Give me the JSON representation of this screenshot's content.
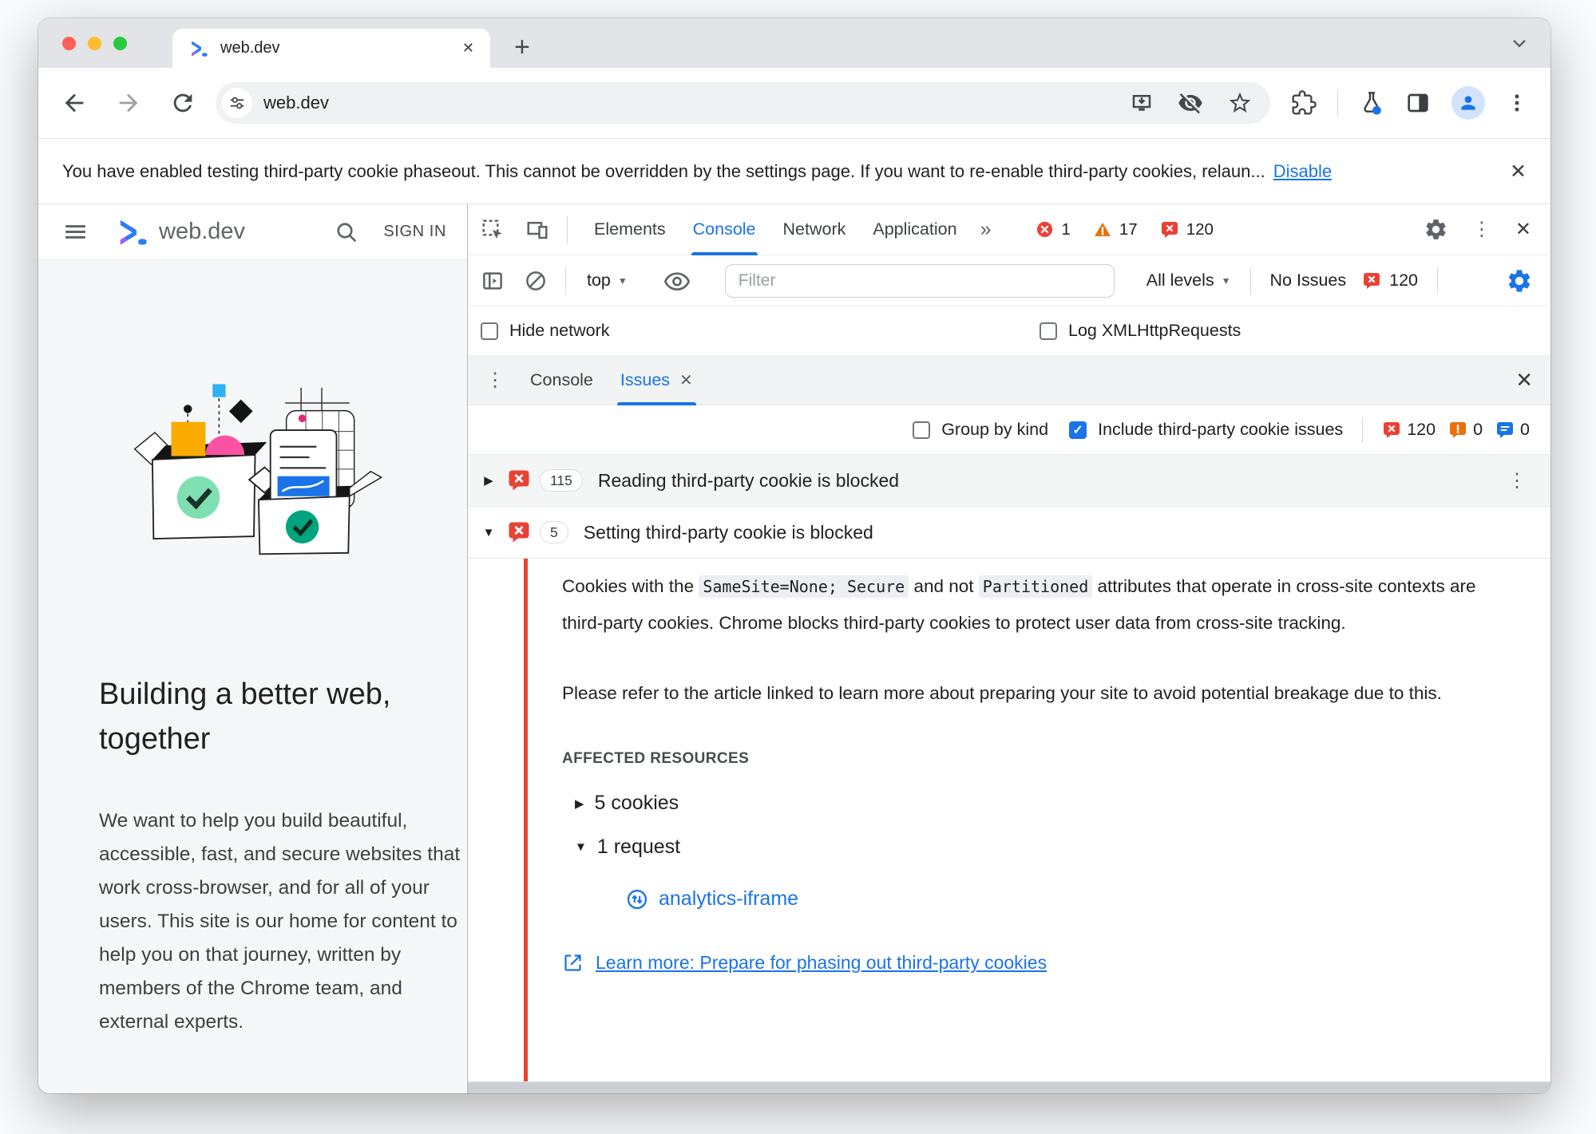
{
  "browser": {
    "tab_title": "web.dev",
    "url": "web.dev",
    "new_tab_glyph": "+",
    "tab_close_glyph": "✕"
  },
  "notification": {
    "message": "You have enabled testing third-party cookie phaseout. This cannot be overridden by the settings page. If you want to re-enable third-party cookies, relaun...",
    "action": "Disable",
    "close_glyph": "✕"
  },
  "site": {
    "brand": "web.dev",
    "sign_in": "SIGN IN",
    "heading": "Building a better web, together",
    "intro": "We want to help you build beautiful, accessible, fast, and secure websites that work cross-browser, and for all of your users. This site is our home for content to help you on that journey, written by members of the Chrome team, and external experts."
  },
  "devtools": {
    "tabs": [
      "Elements",
      "Console",
      "Network",
      "Application"
    ],
    "more_tabs_glyph": "»",
    "error_count": "1",
    "warning_count": "17",
    "issues_count": "120",
    "overflow_glyph": "⋮",
    "close_glyph": "✕",
    "toolbar": {
      "context": "top",
      "dropdown_glyph": "▼",
      "filter_placeholder": "Filter",
      "levels": "All levels",
      "no_issues": "No Issues",
      "issues_badge": "120"
    },
    "settings": {
      "hide_network": "Hide network",
      "log_xhr": "Log XMLHttpRequests"
    },
    "drawer": {
      "overflow_glyph": "⋮",
      "tabs": [
        "Console",
        "Issues"
      ],
      "tab_close_glyph": "✕",
      "close_glyph": "✕"
    },
    "issues_bar": {
      "group_by_kind": "Group by kind",
      "include_third_party": "Include third-party cookie issues",
      "check_glyph": "✓",
      "errors": "120",
      "warnings": "0",
      "info": "0"
    },
    "issues": [
      {
        "caret": "▶",
        "count": "115",
        "title": "Reading third-party cookie is blocked",
        "menu_glyph": "⋮"
      },
      {
        "caret": "▼",
        "count": "5",
        "title": "Setting third-party cookie is blocked"
      }
    ],
    "detail": {
      "p1_t1": "Cookies with the ",
      "p1_c1": "SameSite=None; Secure",
      "p1_t2": " and not ",
      "p1_c2": "Partitioned",
      "p1_t3": " attributes that operate in cross-site contexts are third-party cookies. Chrome blocks third-party cookies to protect user data from cross-site tracking.",
      "p2": "Please refer to the article linked to learn more about preparing your site to avoid potential breakage due to this.",
      "affected_header": "AFFECTED RESOURCES",
      "cookies_caret": "▶",
      "cookies_item": "5 cookies",
      "request_caret": "▼",
      "request_item": "1 request",
      "request_link": "analytics-iframe",
      "learn_more": "Learn more: Prepare for phasing out third-party cookies"
    }
  },
  "colors": {
    "accent_blue": "#1a73e8",
    "error_red": "#e94235",
    "warning_orange": "#e8710a",
    "logo_blue": "#2a7df8",
    "logo_purple": "#a15ff6"
  }
}
